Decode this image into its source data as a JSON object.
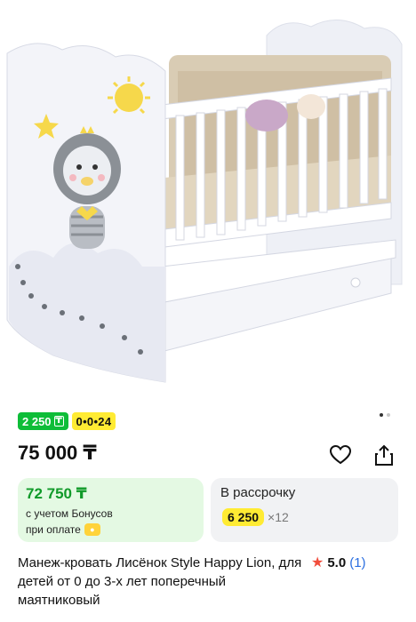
{
  "product": {
    "image_alt": "Манеж-кровать Лисёнок Style Happy Lion",
    "gallery_dots": 2,
    "gallery_active": 1
  },
  "badges": {
    "bonus": "2 250",
    "bonus_icon": "₸",
    "installment": "0•0•24"
  },
  "price": {
    "main": "75 000 ₸"
  },
  "actions": {
    "favorite_icon": "heart-icon",
    "share_icon": "share-icon"
  },
  "bonus_card": {
    "price": "72 750 ₸",
    "line1": "с учетом Бонусов",
    "line2": "при оплате",
    "icon": "bonus-coin-icon"
  },
  "installment_card": {
    "title": "В рассрочку",
    "amount": "6 250",
    "multiplier": "×12"
  },
  "title": {
    "text": "Манеж-кровать Лисёнок Style Happy Lion, для детей от 0 до 3-х лет поперечный маятниковый"
  },
  "rating": {
    "value": "5.0",
    "count": "(1)"
  },
  "colors": {
    "green_badge": "#0ebd38",
    "yellow_badge": "#ffeb33",
    "green_price": "#109a29",
    "star": "#f14d3c",
    "link": "#2a6ee0"
  }
}
